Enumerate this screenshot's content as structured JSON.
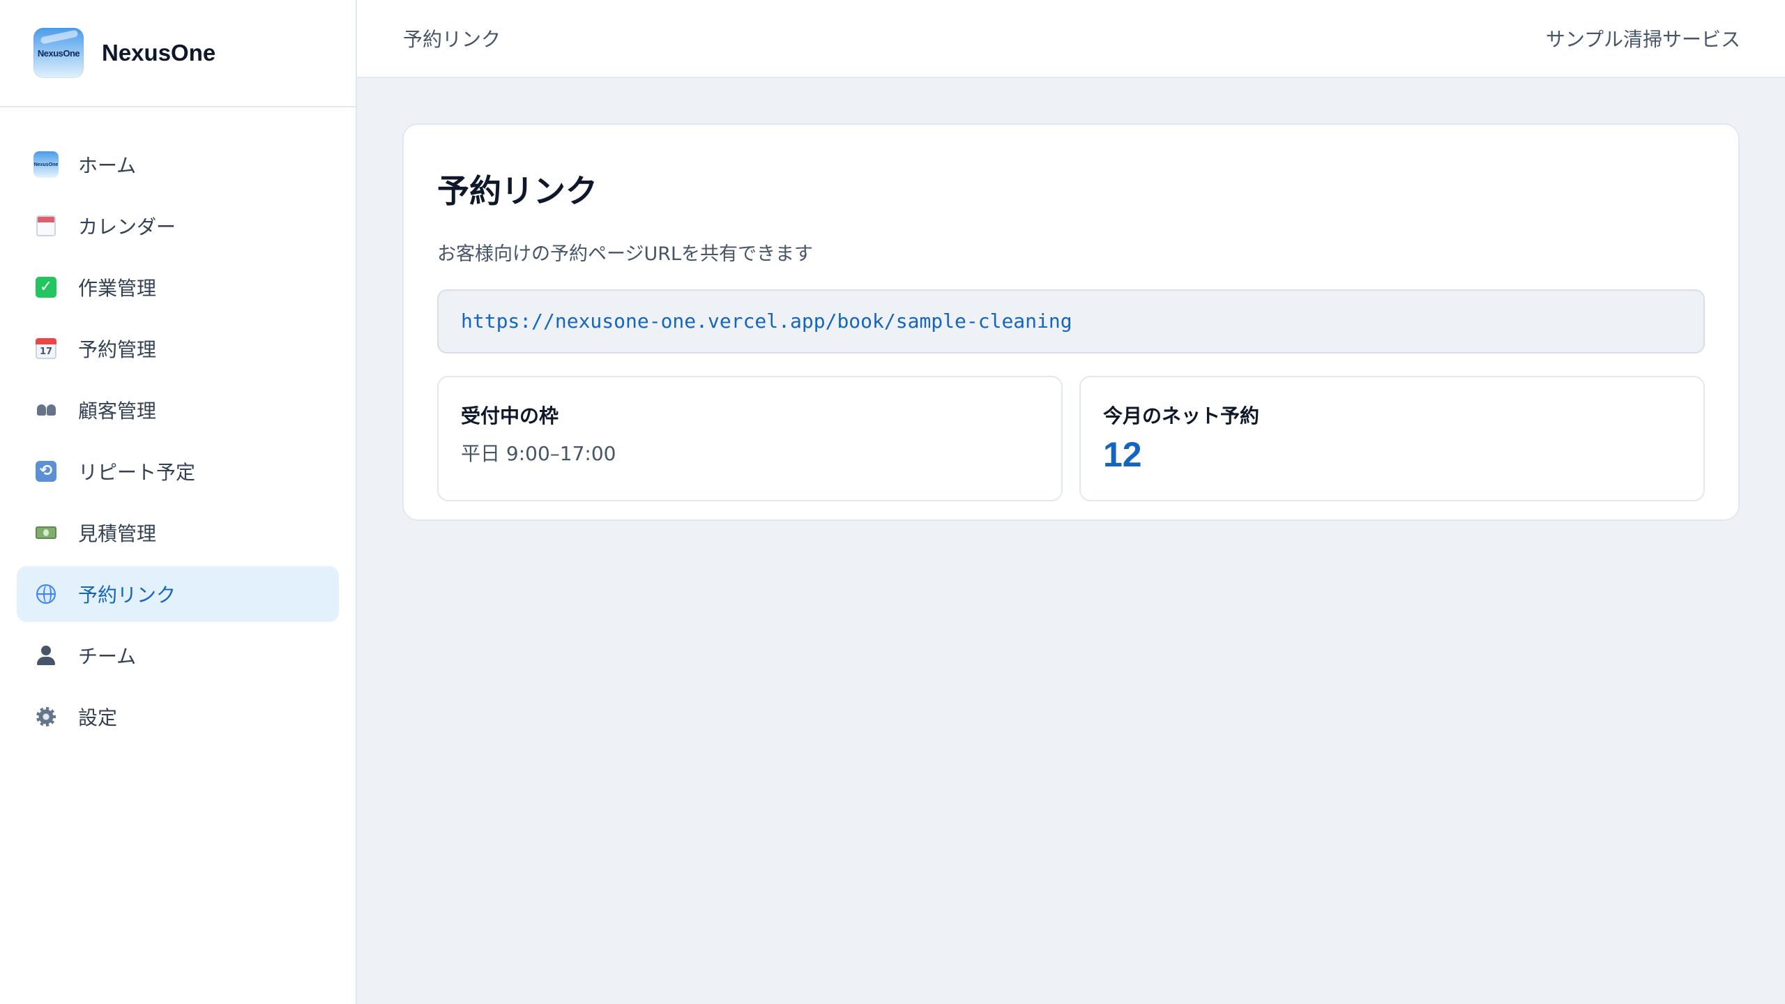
{
  "brand": {
    "name": "NexusOne",
    "logo_text": "NexusOne"
  },
  "sidebar": {
    "items": [
      {
        "label": "ホーム",
        "icon": "home-logo-icon"
      },
      {
        "label": "カレンダー",
        "icon": "calendar-icon"
      },
      {
        "label": "作業管理",
        "icon": "check-box-icon"
      },
      {
        "label": "予約管理",
        "icon": "date-calendar-icon"
      },
      {
        "label": "顧客管理",
        "icon": "users-icon"
      },
      {
        "label": "リピート予定",
        "icon": "repeat-icon"
      },
      {
        "label": "見積管理",
        "icon": "money-icon"
      },
      {
        "label": "予約リンク",
        "icon": "globe-icon",
        "active": true
      },
      {
        "label": "チーム",
        "icon": "person-icon"
      },
      {
        "label": "設定",
        "icon": "gear-icon"
      }
    ],
    "home_icon_text": "NexusOne",
    "date_icon_text": "17",
    "check_icon_text": "✓",
    "repeat_icon_text": "⟲"
  },
  "header": {
    "breadcrumb": "予約リンク",
    "company": "サンプル清掃サービス"
  },
  "main": {
    "title": "予約リンク",
    "description": "お客様向けの予約ページURLを共有できます",
    "url": "https://nexusone-one.vercel.app/book/sample-cleaning",
    "stats": [
      {
        "label": "受付中の枠",
        "value": "平日 9:00–17:00"
      },
      {
        "label": "今月のネット予約",
        "value": "12"
      }
    ]
  },
  "colors": {
    "accent": "#1565c0",
    "active_bg": "#e3f1fc",
    "page_bg": "#eef2f7"
  }
}
